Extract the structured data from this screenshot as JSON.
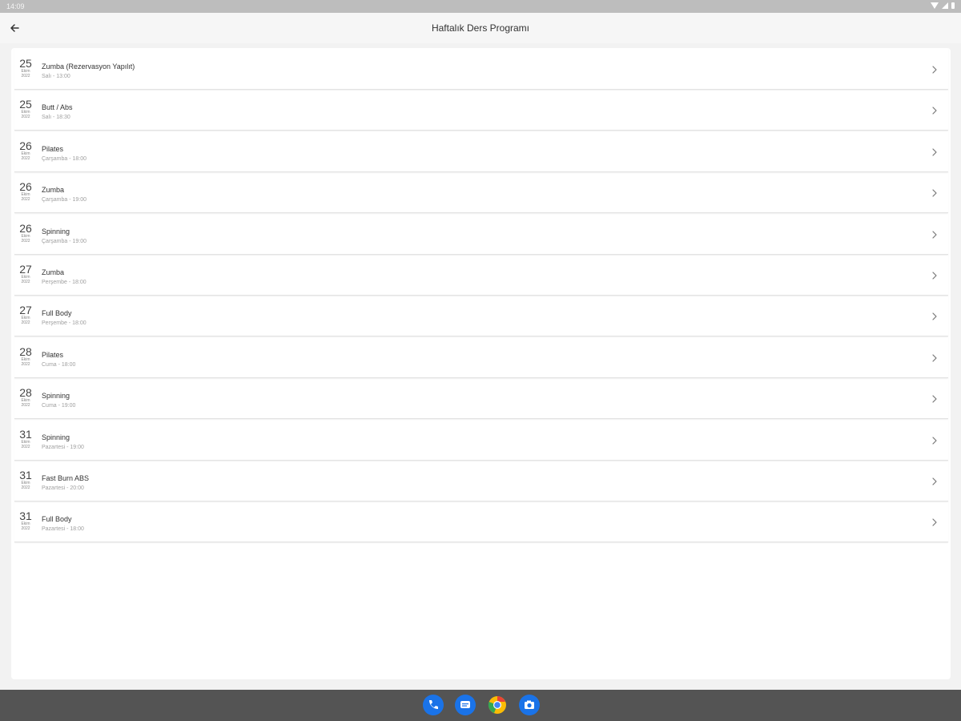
{
  "status_bar": {
    "time": "14:09",
    "icons": [
      "wifi-icon",
      "signal-icon",
      "battery-icon"
    ]
  },
  "app_bar": {
    "title": "Haftalık Ders Programı",
    "back_icon": "arrow-left-icon"
  },
  "classes": [
    {
      "day": "25",
      "month": "Ekim",
      "year": "2022",
      "title": "Zumba (Rezervasyon Yapılıt)",
      "subtitle": "Salı - 13:00"
    },
    {
      "day": "25",
      "month": "Ekim",
      "year": "2022",
      "title": "Butt / Abs",
      "subtitle": "Salı - 18:30"
    },
    {
      "day": "26",
      "month": "Ekim",
      "year": "2022",
      "title": "Pilates",
      "subtitle": "Çarşamba - 18:00"
    },
    {
      "day": "26",
      "month": "Ekim",
      "year": "2022",
      "title": "Zumba",
      "subtitle": "Çarşamba - 19:00"
    },
    {
      "day": "26",
      "month": "Ekim",
      "year": "2022",
      "title": "Spinning",
      "subtitle": "Çarşamba - 19:00"
    },
    {
      "day": "27",
      "month": "Ekim",
      "year": "2022",
      "title": "Zumba",
      "subtitle": "Perşembe - 18:00"
    },
    {
      "day": "27",
      "month": "Ekim",
      "year": "2022",
      "title": "Full Body",
      "subtitle": "Perşembe - 18:00"
    },
    {
      "day": "28",
      "month": "Ekim",
      "year": "2022",
      "title": "Pilates",
      "subtitle": "Cuma - 18:00"
    },
    {
      "day": "28",
      "month": "Ekim",
      "year": "2022",
      "title": "Spinning",
      "subtitle": "Cuma - 19:00"
    },
    {
      "day": "31",
      "month": "Ekim",
      "year": "2022",
      "title": "Spinning",
      "subtitle": "Pazartesi - 19:00"
    },
    {
      "day": "31",
      "month": "Ekim",
      "year": "2022",
      "title": "Fast Burn ABS",
      "subtitle": "Pazartesi - 20:00"
    },
    {
      "day": "31",
      "month": "Ekim",
      "year": "2022",
      "title": "Full Body",
      "subtitle": "Pazartesi - 18:00"
    }
  ],
  "dock": [
    {
      "name": "phone-icon",
      "color": "#1a73e8"
    },
    {
      "name": "messages-icon",
      "color": "#1a73e8"
    },
    {
      "name": "chrome-icon",
      "color": "#ea4335"
    },
    {
      "name": "camera-icon",
      "color": "#1a73e8"
    }
  ],
  "colors": {
    "status_bar": "#bdbdbd",
    "nav_bar": "#545454",
    "card": "#ffffff"
  }
}
